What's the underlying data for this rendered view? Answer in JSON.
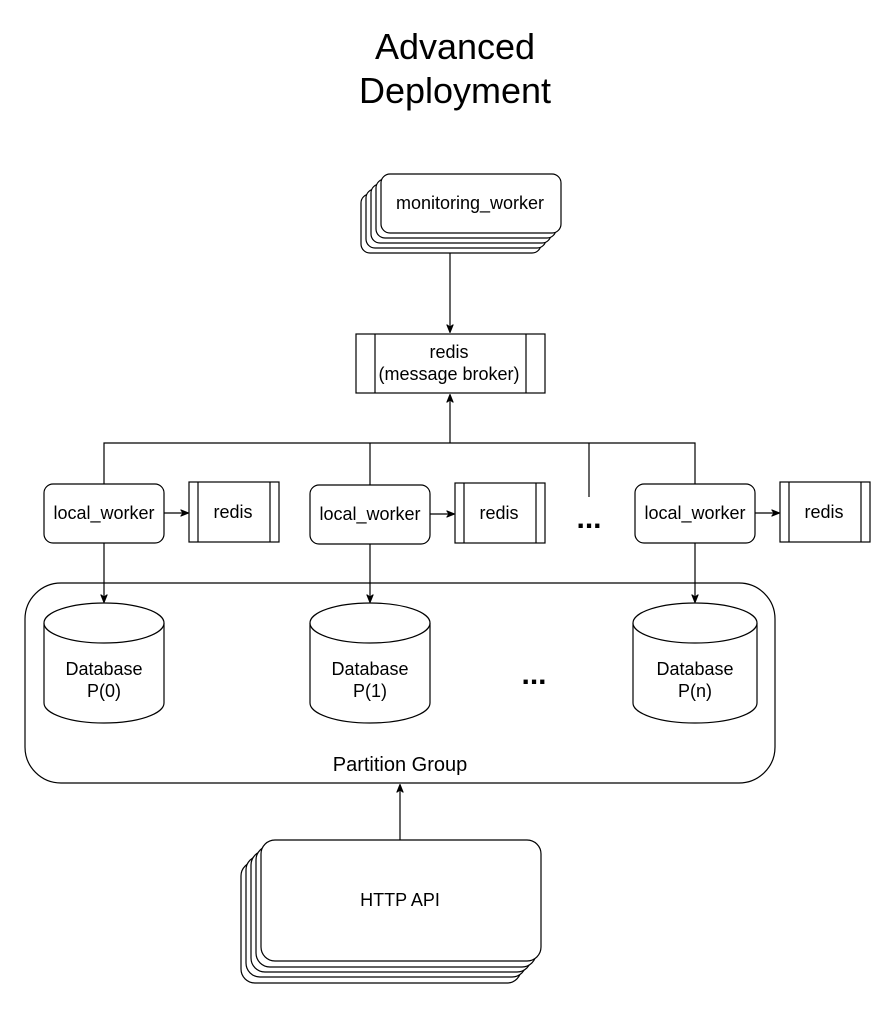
{
  "title": {
    "line1": "Advanced",
    "line2": "Deployment"
  },
  "monitoring_worker": {
    "label": "monitoring_worker"
  },
  "broker": {
    "line1": "redis",
    "line2": "(message broker)"
  },
  "workers": [
    {
      "label": "local_worker",
      "cache_label": "redis"
    },
    {
      "label": "local_worker",
      "cache_label": "redis"
    },
    {
      "label": "local_worker",
      "cache_label": "redis"
    }
  ],
  "worker_ellipsis": "...",
  "partition_group": {
    "label": "Partition Group",
    "databases": [
      {
        "line1": "Database",
        "line2": "P(0)"
      },
      {
        "line1": "Database",
        "line2": "P(1)"
      },
      {
        "line1": "Database",
        "line2": "P(n)"
      }
    ],
    "ellipsis": "..."
  },
  "http_api": {
    "label": "HTTP API"
  }
}
